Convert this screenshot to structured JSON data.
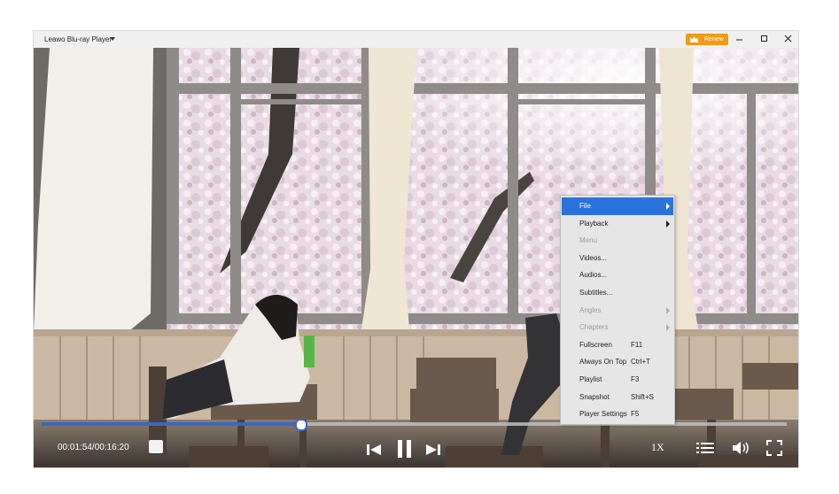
{
  "app": {
    "title": "Leawo Blu-ray Player",
    "renew_label": "Renew",
    "accent": "#f39a16"
  },
  "window_controls": {
    "minimize": "minimize-icon",
    "maximize": "maximize-icon",
    "close": "close-icon"
  },
  "context_menu": {
    "highlight_color": "#2a73dc",
    "items": [
      {
        "label": "File",
        "shortcut": "",
        "submenu": true,
        "enabled": true,
        "highlighted": true
      },
      {
        "label": "Playback",
        "shortcut": "",
        "submenu": true,
        "enabled": true,
        "highlighted": false
      },
      {
        "label": "Menu",
        "shortcut": "",
        "submenu": false,
        "enabled": false,
        "highlighted": false
      },
      {
        "label": "Videos...",
        "shortcut": "",
        "submenu": false,
        "enabled": true,
        "highlighted": false
      },
      {
        "label": "Audios...",
        "shortcut": "",
        "submenu": false,
        "enabled": true,
        "highlighted": false
      },
      {
        "label": "Subtitles...",
        "shortcut": "",
        "submenu": false,
        "enabled": true,
        "highlighted": false
      },
      {
        "label": "Angles",
        "shortcut": "",
        "submenu": true,
        "enabled": false,
        "highlighted": false
      },
      {
        "label": "Chapters",
        "shortcut": "",
        "submenu": true,
        "enabled": false,
        "highlighted": false
      },
      {
        "label": "Fullscreen",
        "shortcut": "F11",
        "submenu": false,
        "enabled": true,
        "highlighted": false
      },
      {
        "label": "Always On Top",
        "shortcut": "Ctrl+T",
        "submenu": false,
        "enabled": true,
        "highlighted": false
      },
      {
        "label": "Playlist",
        "shortcut": "F3",
        "submenu": false,
        "enabled": true,
        "highlighted": false
      },
      {
        "label": "Snapshot",
        "shortcut": "Shift+S",
        "submenu": false,
        "enabled": true,
        "highlighted": false
      },
      {
        "label": "Player Settings",
        "shortcut": "F5",
        "submenu": false,
        "enabled": true,
        "highlighted": false
      }
    ]
  },
  "player": {
    "time": "00:01:54/00:16:20",
    "progress": 0.3485,
    "progress_color": "#3c66c6",
    "speed": "1X",
    "controls": [
      "stop-icon",
      "previous-icon",
      "pause-icon",
      "next-icon",
      "playlist-icon",
      "volume-icon",
      "fullscreen-icon"
    ]
  }
}
